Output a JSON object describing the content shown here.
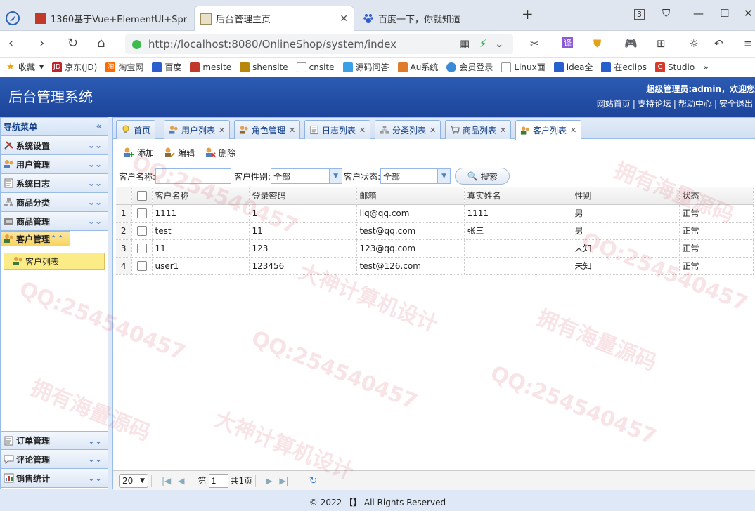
{
  "browser": {
    "tabs": [
      {
        "title": "1360基于Vue+ElementUI+Spr"
      },
      {
        "title": "后台管理主页"
      },
      {
        "title": "百度一下，你就知道"
      }
    ],
    "url": "http://localhost:8080/OnlineShop/system/index",
    "bookmarks": [
      "收藏",
      "京东(JD)",
      "淘宝网",
      "百度",
      "mesite",
      "shensite",
      "cnsite",
      "源码问答",
      "Au系统",
      "会员登录",
      "Linux面",
      "idea全",
      "在eclips",
      "Studio"
    ]
  },
  "app": {
    "title": "后台管理系统",
    "welcome": "超级管理员:admin，欢迎您",
    "top_links": [
      "网站首页",
      "支持论坛",
      "帮助中心",
      "安全退出"
    ]
  },
  "sidebar": {
    "header": "导航菜单",
    "groups": [
      {
        "label": "系统设置"
      },
      {
        "label": "用户管理"
      },
      {
        "label": "系统日志"
      },
      {
        "label": "商品分类"
      },
      {
        "label": "商品管理"
      },
      {
        "label": "客户管理"
      }
    ],
    "sub_item": "客户列表",
    "bottom_groups": [
      {
        "label": "订单管理"
      },
      {
        "label": "评论管理"
      },
      {
        "label": "销售统计"
      }
    ]
  },
  "tabs": [
    {
      "label": "首页"
    },
    {
      "label": "用户列表"
    },
    {
      "label": "角色管理"
    },
    {
      "label": "日志列表"
    },
    {
      "label": "分类列表"
    },
    {
      "label": "商品列表"
    },
    {
      "label": "客户列表"
    }
  ],
  "toolbar": {
    "add": "添加",
    "edit": "编辑",
    "delete": "删除"
  },
  "search": {
    "name_label": "客户名称:",
    "name_value": "",
    "gender_label": "客户性别:",
    "gender_value": "全部",
    "status_label": "客户状态:",
    "status_value": "全部",
    "button": "搜索"
  },
  "table": {
    "columns": [
      "客户名称",
      "登录密码",
      "邮箱",
      "真实姓名",
      "性别",
      "状态"
    ],
    "rows": [
      {
        "n": "1",
        "name": "1111",
        "pwd": "1",
        "email": "llq@qq.com",
        "real": "1111",
        "gender": "男",
        "status": "正常"
      },
      {
        "n": "2",
        "name": "test",
        "pwd": "11",
        "email": "test@qq.com",
        "real": "张三",
        "gender": "男",
        "status": "正常"
      },
      {
        "n": "3",
        "name": "11",
        "pwd": "123",
        "email": "123@qq.com",
        "real": "",
        "gender": "未知",
        "status": "正常"
      },
      {
        "n": "4",
        "name": "user1",
        "pwd": "123456",
        "email": "test@126.com",
        "real": "",
        "gender": "未知",
        "status": "正常"
      }
    ]
  },
  "pager": {
    "page_size": "20",
    "page_prefix": "第",
    "page_value": "1",
    "total": "共1页"
  },
  "footer": "© 2022 【】 All Rights Reserved",
  "watermarks": [
    "QQ:254540457",
    "大神计算机设计",
    "拥有海量源码"
  ]
}
